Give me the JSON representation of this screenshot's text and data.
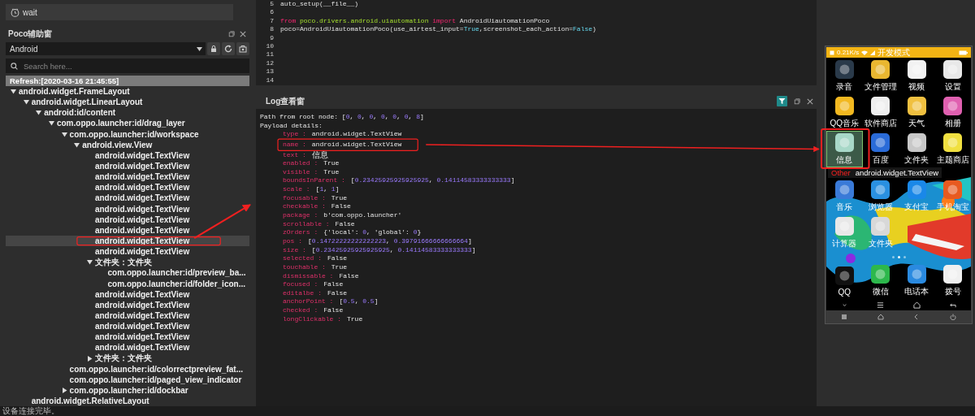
{
  "toolbar": {
    "wait_label": "wait"
  },
  "poco_panel": {
    "title": "Poco辅助窗",
    "platform": "Android",
    "search": {
      "placeholder": "Search here..."
    },
    "refresh_label": "Refresh:[2020-03-16 21:45:55]",
    "tree": [
      {
        "label": "android.widget.FrameLayout",
        "expanded": true,
        "selected": false,
        "children": [
          {
            "label": "android.widget.LinearLayout",
            "expanded": true,
            "selected": false,
            "children": [
              {
                "label": "android:id/content",
                "expanded": true,
                "selected": false,
                "children": [
                  {
                    "label": "com.oppo.launcher:id/drag_layer",
                    "expanded": true,
                    "selected": false,
                    "children": [
                      {
                        "label": "com.oppo.launcher:id/workspace",
                        "expanded": true,
                        "selected": false,
                        "children": [
                          {
                            "label": "android.view.View",
                            "expanded": true,
                            "selected": false,
                            "children": [
                              {
                                "label": "android.widget.TextView",
                                "selected": false
                              },
                              {
                                "label": "android.widget.TextView",
                                "selected": false
                              },
                              {
                                "label": "android.widget.TextView",
                                "selected": false
                              },
                              {
                                "label": "android.widget.TextView",
                                "selected": false
                              },
                              {
                                "label": "android.widget.TextView",
                                "selected": false
                              },
                              {
                                "label": "android.widget.TextView",
                                "selected": false
                              },
                              {
                                "label": "android.widget.TextView",
                                "selected": false
                              },
                              {
                                "label": "android.widget.TextView",
                                "selected": false
                              },
                              {
                                "label": "android.widget.TextView",
                                "selected": true
                              },
                              {
                                "label": "android.widget.TextView",
                                "selected": false
                              },
                              {
                                "label": "文件夹：文件夹",
                                "expanded": true,
                                "selected": false,
                                "children": [
                                  {
                                    "label": "com.oppo.launcher:id/preview_ba...",
                                    "selected": false
                                  },
                                  {
                                    "label": "com.oppo.launcher:id/folder_icon...",
                                    "selected": false
                                  }
                                ]
                              },
                              {
                                "label": "android.widget.TextView",
                                "selected": false
                              },
                              {
                                "label": "android.widget.TextView",
                                "selected": false
                              },
                              {
                                "label": "android.widget.TextView",
                                "selected": false
                              },
                              {
                                "label": "android.widget.TextView",
                                "selected": false
                              },
                              {
                                "label": "android.widget.TextView",
                                "selected": false
                              },
                              {
                                "label": "android.widget.TextView",
                                "selected": false
                              },
                              {
                                "label": "文件夹：文件夹",
                                "expanded": false,
                                "selected": false
                              }
                            ]
                          }
                        ]
                      },
                      {
                        "label": "com.oppo.launcher:id/colorrectpreview_fat...",
                        "selected": false
                      },
                      {
                        "label": "com.oppo.launcher:id/paged_view_indicator",
                        "selected": false
                      },
                      {
                        "label": "com.oppo.launcher:id/dockbar",
                        "expanded": false,
                        "selected": false
                      }
                    ]
                  }
                ]
              }
            ]
          },
          {
            "label": "android.widget.RelativeLayout",
            "selected": false
          }
        ]
      }
    ]
  },
  "editor": {
    "lines": [
      {
        "number": "5",
        "tokens": [
          {
            "kind": "plain",
            "text": "auto_setup(__file__)"
          }
        ]
      },
      {
        "number": "6"
      },
      {
        "number": "7",
        "tokens": [
          {
            "kind": "keyword",
            "text": "from"
          },
          {
            "kind": "module",
            "text": " poco.drivers.android.uiautomation"
          },
          {
            "kind": "keyword",
            "text": " import"
          },
          {
            "kind": "plain",
            "text": " AndroidUiautomationPoco"
          }
        ]
      },
      {
        "number": "8",
        "tokens": [
          {
            "kind": "plain",
            "text": "poco=AndroidUiautomationPoco(use_airtest_input="
          },
          {
            "kind": "constant",
            "text": "True"
          },
          {
            "kind": "plain",
            "text": ",screenshot_each_action="
          },
          {
            "kind": "constant",
            "text": "False"
          },
          {
            "kind": "plain",
            "text": ")"
          }
        ]
      },
      {
        "number": "9"
      },
      {
        "number": "10"
      },
      {
        "number": "11"
      },
      {
        "number": "12"
      },
      {
        "number": "13"
      },
      {
        "number": "14"
      }
    ]
  },
  "log_panel": {
    "title": "Log查看窗",
    "filter_on": true,
    "path_line": "Path from root node: [0, 0, 0, 0, 0, 0, 8]",
    "payload_heading": "Payload details:",
    "entries": [
      {
        "key": "type :",
        "value": "android.widget.TextView"
      },
      {
        "key": "name :",
        "value": "android.widget.TextView"
      },
      {
        "key": "text :",
        "value": "信息"
      },
      {
        "key": "enabled :",
        "value": "True"
      },
      {
        "key": "visible :",
        "value": "True"
      },
      {
        "key": "boundsInParent :",
        "value": "[0.23425925925925925, 0.14114583333333333]"
      },
      {
        "key": "scale :",
        "value": "[1, 1]"
      },
      {
        "key": "focusable :",
        "value": "True"
      },
      {
        "key": "checkable :",
        "value": "False"
      },
      {
        "key": "package :",
        "value": "b'com.oppo.launcher'"
      },
      {
        "key": "scrollable :",
        "value": "False"
      },
      {
        "key": "zOrders :",
        "value": "{'local': 0, 'global': 0}"
      },
      {
        "key": "pos :",
        "value": "[0.14722222222222223, 0.39791666666666664]"
      },
      {
        "key": "size :",
        "value": "[0.23425925925925925, 0.14114583333333333]"
      },
      {
        "key": "selected :",
        "value": "False"
      },
      {
        "key": "touchable :",
        "value": "True"
      },
      {
        "key": "dismissable :",
        "value": "False"
      },
      {
        "key": "focused :",
        "value": "False"
      },
      {
        "key": "editalbe :",
        "value": "False"
      },
      {
        "key": "anchorPoint :",
        "value": "[0.5, 0.5]"
      },
      {
        "key": "checked :",
        "value": "False"
      },
      {
        "key": "longClickable :",
        "value": "True"
      }
    ]
  },
  "device": {
    "status_bar": {
      "speed": "0.21K/s",
      "mode": "开发模式"
    },
    "apps": [
      {
        "label": "录音",
        "selected": false
      },
      {
        "label": "文件管理",
        "selected": false
      },
      {
        "label": "视频",
        "selected": false
      },
      {
        "label": "设置",
        "selected": false
      },
      {
        "label": "QQ音乐",
        "selected": false
      },
      {
        "label": "软件商店",
        "selected": false
      },
      {
        "label": "天气",
        "selected": false
      },
      {
        "label": "相册",
        "selected": false
      },
      {
        "label": "信息",
        "selected": true
      },
      {
        "label": "百度",
        "selected": false
      },
      {
        "label": "文件夹",
        "selected": false
      },
      {
        "label": "主题商店",
        "selected": false
      },
      {
        "label": "音乐",
        "selected": false
      },
      {
        "label": "浏览器",
        "selected": false
      },
      {
        "label": "支付宝",
        "selected": false
      },
      {
        "label": "手机淘宝",
        "selected": false
      },
      {
        "label": "计算器",
        "selected": false
      },
      {
        "label": "文件夹",
        "selected": false
      }
    ],
    "overlay": {
      "tag": "Other",
      "type": "android.widget.TextView"
    },
    "dock": [
      {
        "label": "QQ"
      },
      {
        "label": "微信"
      },
      {
        "label": "电话本"
      },
      {
        "label": "拨号"
      }
    ]
  },
  "status_bar": {
    "text": "设备连接完毕。"
  }
}
